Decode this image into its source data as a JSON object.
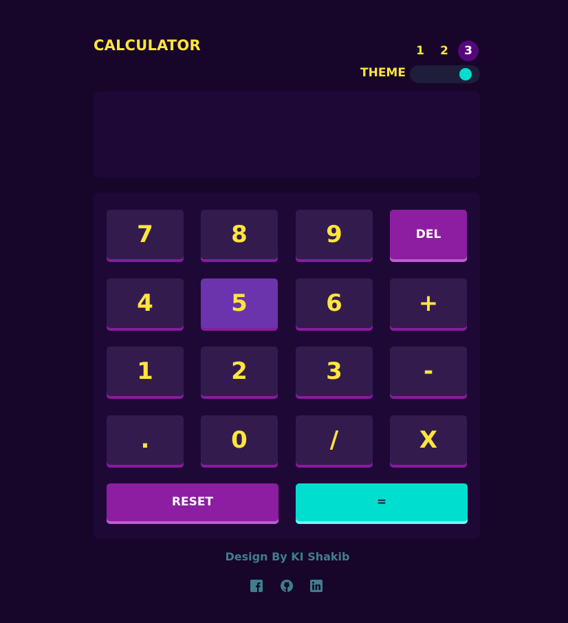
{
  "header": {
    "title": "CALCULATOR",
    "theme_label": "THEME",
    "theme_options": [
      "1",
      "2",
      "3"
    ],
    "active_theme": "3"
  },
  "display": {
    "value": ""
  },
  "keypad": {
    "rows": [
      [
        "7",
        "8",
        "9",
        "DEL"
      ],
      [
        "4",
        "5",
        "6",
        "+"
      ],
      [
        "1",
        "2",
        "3",
        "-"
      ],
      [
        ".",
        "0",
        "/",
        "X"
      ]
    ],
    "reset_label": "RESET",
    "equals_label": "="
  },
  "footer": {
    "credit": "Design By KI Shakib",
    "social_icons": [
      "facebook-icon",
      "github-icon",
      "linkedin-icon"
    ]
  },
  "colors": {
    "background": "#17062a",
    "panel": "#1e0836",
    "key": "#331c4d",
    "key_active": "#6c34ac",
    "key_text": "#ffe53d",
    "accent_purple": "#8d1ea1",
    "accent_cyan": "#00decf",
    "footer_text": "#3f7e8e"
  }
}
